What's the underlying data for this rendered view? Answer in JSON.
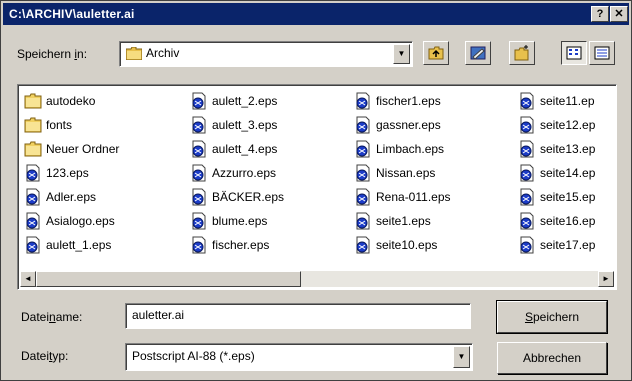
{
  "window": {
    "title": "C:\\ARCHIV\\auletter.ai",
    "help_label": "?",
    "close_label": "✕"
  },
  "location": {
    "label_pre": "Speichern ",
    "label_key": "i",
    "label_post": "n:",
    "value": "Archiv",
    "folder_icon": "folder-icon"
  },
  "toolbar": {
    "items": [
      "up-folder-icon",
      "desktop-icon",
      "new-folder-icon",
      "list-view-icon",
      "details-view-icon"
    ]
  },
  "files": {
    "columns": [
      [
        {
          "name": "autodeko",
          "kind": "folder"
        },
        {
          "name": "fonts",
          "kind": "folder"
        },
        {
          "name": "Neuer Ordner",
          "kind": "folder"
        },
        {
          "name": "123.eps",
          "kind": "eps"
        },
        {
          "name": "Adler.eps",
          "kind": "eps"
        },
        {
          "name": "Asialogo.eps",
          "kind": "eps"
        },
        {
          "name": "aulett_1.eps",
          "kind": "eps"
        }
      ],
      [
        {
          "name": "aulett_2.eps",
          "kind": "eps"
        },
        {
          "name": "aulett_3.eps",
          "kind": "eps"
        },
        {
          "name": "aulett_4.eps",
          "kind": "eps"
        },
        {
          "name": "Azzurro.eps",
          "kind": "eps"
        },
        {
          "name": "BÄCKER.eps",
          "kind": "eps"
        },
        {
          "name": "blume.eps",
          "kind": "eps"
        },
        {
          "name": "fischer.eps",
          "kind": "eps"
        }
      ],
      [
        {
          "name": "fischer1.eps",
          "kind": "eps"
        },
        {
          "name": "gassner.eps",
          "kind": "eps"
        },
        {
          "name": "Limbach.eps",
          "kind": "eps"
        },
        {
          "name": "Nissan.eps",
          "kind": "eps"
        },
        {
          "name": "Rena-011.eps",
          "kind": "eps"
        },
        {
          "name": "seite1.eps",
          "kind": "eps"
        },
        {
          "name": "seite10.eps",
          "kind": "eps"
        }
      ],
      [
        {
          "name": "seite11.ep",
          "kind": "eps"
        },
        {
          "name": "seite12.ep",
          "kind": "eps"
        },
        {
          "name": "seite13.ep",
          "kind": "eps"
        },
        {
          "name": "seite14.ep",
          "kind": "eps"
        },
        {
          "name": "seite15.ep",
          "kind": "eps"
        },
        {
          "name": "seite16.ep",
          "kind": "eps"
        },
        {
          "name": "seite17.ep",
          "kind": "eps"
        }
      ]
    ]
  },
  "scrollbar": {
    "left_arrow": "◄",
    "right_arrow": "►"
  },
  "filename": {
    "label_pre": "Datei",
    "label_key": "n",
    "label_post": "ame:",
    "value": "auletter.ai"
  },
  "filetype": {
    "label_pre": "Datei",
    "label_key": "t",
    "label_post": "yp:",
    "value": "Postscript AI-88 (*.eps)",
    "arrow": "▼"
  },
  "buttons": {
    "save_key": "S",
    "save_rest": "peichern",
    "cancel": "Abbrechen"
  },
  "colors": {
    "titlebar": "#0a246a",
    "dialog": "#d4d0c8",
    "folder": "#f0d060",
    "eps_icon": "#1c3cc8"
  }
}
